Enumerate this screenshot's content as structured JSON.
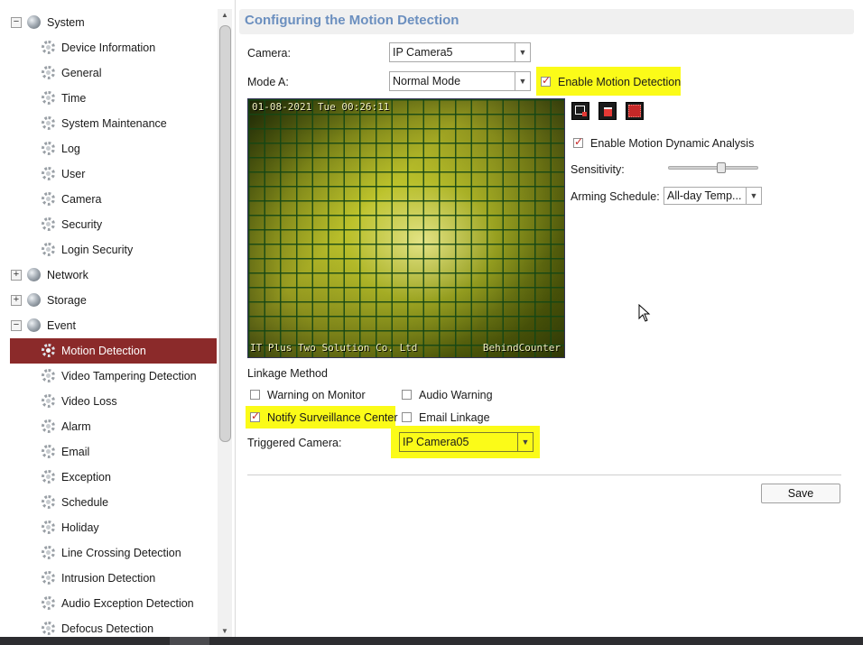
{
  "sidebar": {
    "items": [
      {
        "label": "System",
        "level": "top",
        "toggle": "−"
      },
      {
        "label": "Device Information",
        "level": "sub"
      },
      {
        "label": "General",
        "level": "sub"
      },
      {
        "label": "Time",
        "level": "sub"
      },
      {
        "label": "System Maintenance",
        "level": "sub"
      },
      {
        "label": "Log",
        "level": "sub"
      },
      {
        "label": "User",
        "level": "sub"
      },
      {
        "label": "Camera",
        "level": "sub"
      },
      {
        "label": "Security",
        "level": "sub"
      },
      {
        "label": "Login Security",
        "level": "sub"
      },
      {
        "label": "Network",
        "level": "top",
        "toggle": "+"
      },
      {
        "label": "Storage",
        "level": "top",
        "toggle": "+"
      },
      {
        "label": "Event",
        "level": "top",
        "toggle": "−"
      },
      {
        "label": "Motion Detection",
        "level": "sub",
        "selected": true
      },
      {
        "label": "Video Tampering Detection",
        "level": "sub"
      },
      {
        "label": "Video Loss",
        "level": "sub"
      },
      {
        "label": "Alarm",
        "level": "sub"
      },
      {
        "label": "Email",
        "level": "sub"
      },
      {
        "label": "Exception",
        "level": "sub"
      },
      {
        "label": "Schedule",
        "level": "sub"
      },
      {
        "label": "Holiday",
        "level": "sub"
      },
      {
        "label": "Line Crossing Detection",
        "level": "sub"
      },
      {
        "label": "Intrusion Detection",
        "level": "sub"
      },
      {
        "label": "Audio Exception Detection",
        "level": "sub"
      },
      {
        "label": "Defocus Detection",
        "level": "sub"
      }
    ]
  },
  "header": {
    "title": "Configuring the Motion Detection"
  },
  "form": {
    "camera_label": "Camera:",
    "camera_value": "IP Camera5",
    "mode_label": "Mode A:",
    "mode_value": "Normal Mode",
    "enable_motion_label": "Enable Motion Detection",
    "enable_motion_checked": true,
    "enable_dynamic_label": "Enable Motion Dynamic Analysis",
    "enable_dynamic_checked": true,
    "sensitivity_label": "Sensitivity:",
    "sensitivity_level": 0.6,
    "arming_label": "Arming Schedule:",
    "arming_value": "All-day Temp..."
  },
  "video": {
    "timestamp": "01-08-2021 Tue 00:26:11",
    "company": "IT Plus Two Solution Co. Ltd",
    "channel_name": "BehindCounter"
  },
  "toolbar": {
    "icons": [
      "draw-area-icon",
      "delete-icon",
      "select-all-icon"
    ]
  },
  "linkage": {
    "title": "Linkage Method",
    "warning_on_monitor": {
      "label": "Warning on Monitor",
      "checked": false
    },
    "audio_warning": {
      "label": "Audio Warning",
      "checked": false
    },
    "notify_center": {
      "label": "Notify Surveillance Center",
      "checked": true
    },
    "email_linkage": {
      "label": "Email Linkage",
      "checked": false
    },
    "triggered_label": "Triggered Camera:",
    "triggered_value": "IP Camera05"
  },
  "actions": {
    "save_label": "Save"
  },
  "colors": {
    "selected_bg": "#8b2a2a",
    "title_color": "#6b8fbf",
    "highlight": "#fbfb18",
    "check_mark": "#c62828"
  }
}
